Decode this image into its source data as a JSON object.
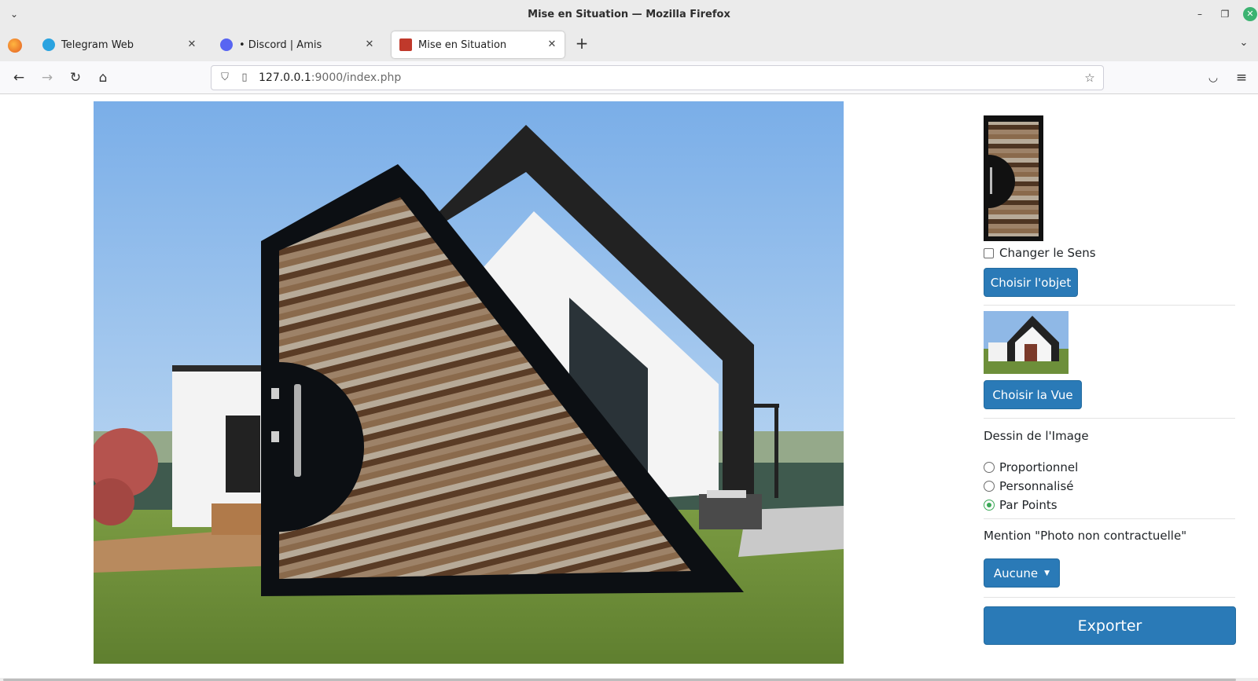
{
  "window": {
    "title": "Mise en Situation — Mozilla Firefox",
    "close_color": "#3cb371"
  },
  "tabs": [
    {
      "label": "Telegram Web",
      "icon": "telegram-icon",
      "color": "#2aa3e0"
    },
    {
      "label": "• Discord | Amis",
      "icon": "discord-icon",
      "color": "#5865f2"
    },
    {
      "label": "Mise en Situation",
      "icon": "site-icon",
      "color": "#c0392b",
      "active": true
    }
  ],
  "address_bar": {
    "host": "127.0.0.1",
    "rest": ":9000/index.php"
  },
  "sidebar": {
    "change_direction_label": "Changer le Sens",
    "change_direction_checked": false,
    "choose_object_label": "Choisir l'objet",
    "choose_view_label": "Choisir la Vue",
    "drawing_heading": "Dessin de l'Image",
    "drawing_options": [
      {
        "label": "Proportionnel",
        "checked": false
      },
      {
        "label": "Personnalisé",
        "checked": false
      },
      {
        "label": "Par Points",
        "checked": true
      }
    ],
    "mention_heading": "Mention \"Photo non contractuelle\"",
    "mention_dropdown_label": "Aucune",
    "export_label": "Exporter",
    "button_color": "#2a7ab7"
  }
}
